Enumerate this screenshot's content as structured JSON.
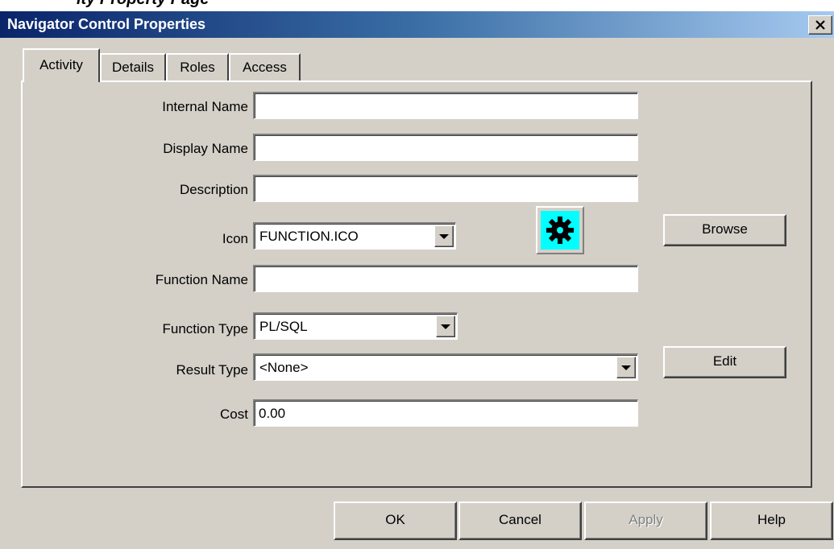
{
  "window": {
    "top_clip_text": "ity Property Page",
    "title": "Navigator Control Properties",
    "close_symbol": "X",
    "titlebar_color": "#0a246a",
    "face_color": "#d4d0c8"
  },
  "tabs": [
    {
      "label": "Activity",
      "active": true
    },
    {
      "label": "Details",
      "active": false
    },
    {
      "label": "Roles",
      "active": false
    },
    {
      "label": "Access",
      "active": false
    }
  ],
  "form": {
    "internal_name": {
      "label": "Internal Name",
      "value": ""
    },
    "display_name": {
      "label": "Display Name",
      "value": ""
    },
    "description": {
      "label": "Description",
      "value": ""
    },
    "icon": {
      "label": "Icon",
      "value": "FUNCTION.ICO",
      "preview_icon": "gear-icon",
      "preview_bg": "#00ffff"
    },
    "function_name": {
      "label": "Function Name",
      "value": ""
    },
    "function_type": {
      "label": "Function Type",
      "value": "PL/SQL"
    },
    "result_type": {
      "label": "Result Type",
      "value": "<None>"
    },
    "cost": {
      "label": "Cost",
      "value": "0.00"
    }
  },
  "side_buttons": {
    "browse": "Browse",
    "edit": "Edit"
  },
  "footer": {
    "ok": "OK",
    "cancel": "Cancel",
    "apply": "Apply",
    "apply_enabled": false,
    "help": "Help"
  }
}
